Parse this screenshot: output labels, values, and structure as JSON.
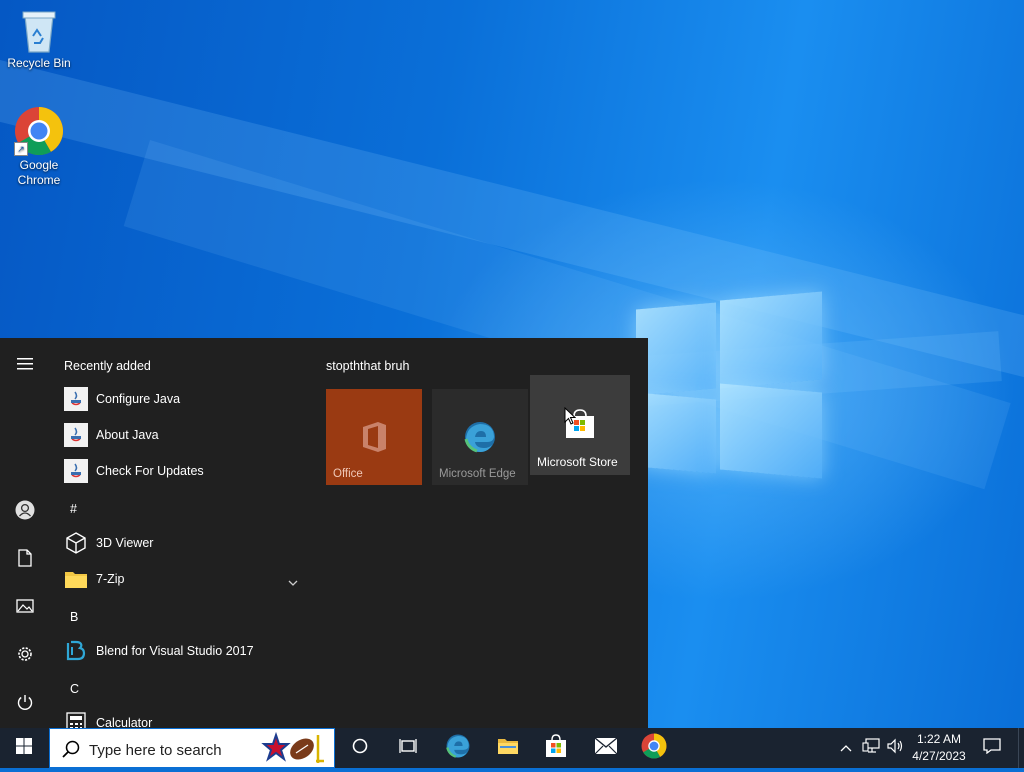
{
  "desktop": {
    "icons": [
      {
        "label": "Recycle Bin",
        "icon": "recycle-bin-icon"
      },
      {
        "label": "Google Chrome",
        "icon": "chrome-icon"
      }
    ]
  },
  "start_menu": {
    "rail": [
      "hamburger-menu-icon",
      "user-account-icon",
      "documents-icon",
      "pictures-icon",
      "settings-icon",
      "power-icon"
    ],
    "recently_added_label": "Recently added",
    "recent_items": [
      {
        "label": "Configure Java",
        "icon": "java-icon"
      },
      {
        "label": "About Java",
        "icon": "java-icon"
      },
      {
        "label": "Check For Updates",
        "icon": "java-icon"
      }
    ],
    "sections": [
      {
        "letter": "#",
        "items": [
          {
            "label": "3D Viewer",
            "icon": "3d-viewer-icon"
          },
          {
            "label": "7-Zip",
            "icon": "folder-icon",
            "expandable": true
          }
        ]
      },
      {
        "letter": "B",
        "items": [
          {
            "label": "Blend for Visual Studio 2017",
            "icon": "blend-icon"
          }
        ]
      },
      {
        "letter": "C",
        "items": [
          {
            "label": "Calculator",
            "icon": "calculator-icon"
          }
        ]
      }
    ],
    "tile_group": {
      "title": "stopththat bruh",
      "tiles": [
        {
          "label": "Office",
          "icon": "office-icon",
          "color": "#9a3a12"
        },
        {
          "label": "Microsoft Edge",
          "icon": "edge-icon",
          "color": "#2b2b2b"
        },
        {
          "label": "Microsoft Store",
          "icon": "store-icon",
          "color": "#3c3c3c"
        }
      ]
    }
  },
  "taskbar": {
    "start_icon": "windows-start-icon",
    "search_placeholder": "Type here to search",
    "pinned": [
      "cortana-icon",
      "task-view-icon",
      "edge-icon",
      "file-explorer-icon",
      "microsoft-store-icon",
      "mail-icon",
      "chrome-icon"
    ],
    "tray": [
      "show-hidden-icons-chevron",
      "network-icon",
      "volume-icon"
    ],
    "time": "1:22 AM",
    "date": "4/27/2023",
    "notification_icon": "action-center-icon"
  },
  "colors": {
    "accent": "#0a6fd4",
    "start_bg": "#202020",
    "taskbar_bg": "#1a2330"
  }
}
